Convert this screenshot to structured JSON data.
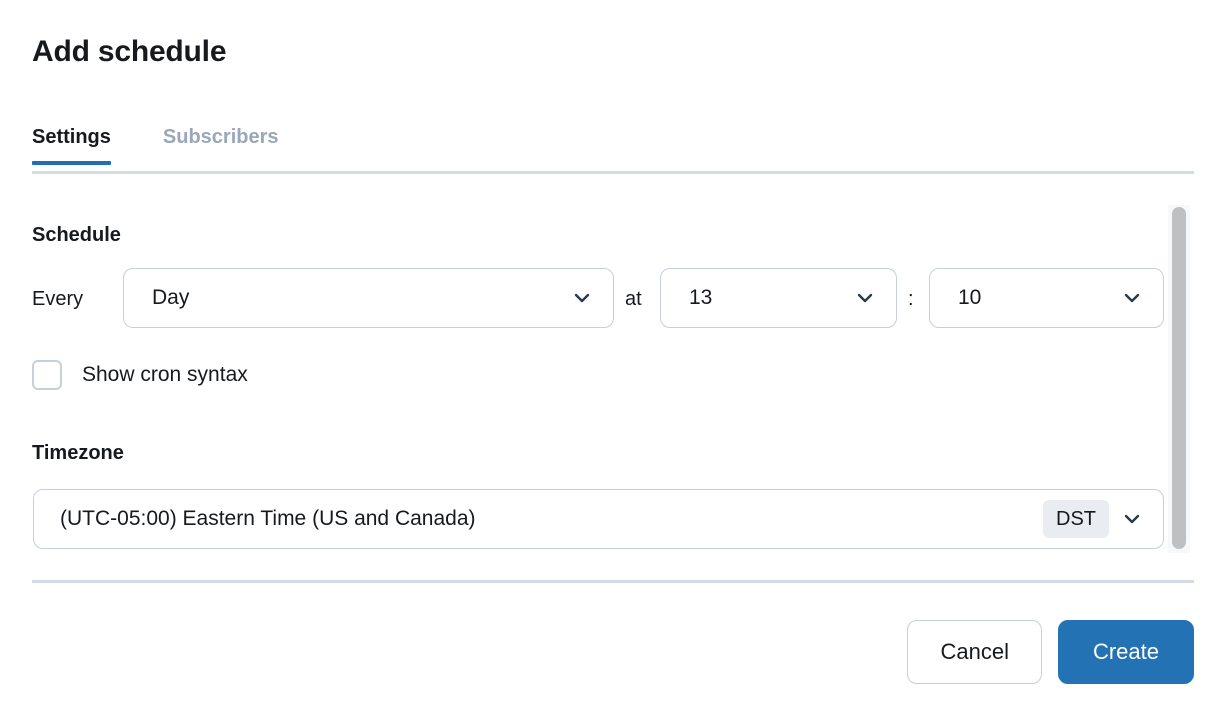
{
  "dialog": {
    "title": "Add schedule"
  },
  "tabs": [
    {
      "label": "Settings",
      "active": true
    },
    {
      "label": "Subscribers",
      "active": false
    }
  ],
  "settings": {
    "schedule": {
      "heading": "Schedule",
      "every_label": "Every",
      "frequency_value": "Day",
      "at_label": "at",
      "hour_value": "13",
      "time_separator": ":",
      "minute_value": "10",
      "cron_checkbox": {
        "label": "Show cron syntax",
        "checked": false
      }
    },
    "timezone": {
      "heading": "Timezone",
      "value": "(UTC-05:00) Eastern Time (US and Canada)",
      "badge": "DST"
    }
  },
  "footer": {
    "cancel_label": "Cancel",
    "create_label": "Create"
  },
  "colors": {
    "accent_blue": "#2272b4",
    "tab_underline": "#1f6fb2",
    "border": "#c5d0db",
    "divider": "#d3dce6",
    "inactive_tab_text": "#9ba7b6",
    "badge_background": "#e9edf2",
    "text": "#16191d",
    "scrollbar_thumb": "#bfc0c2"
  }
}
